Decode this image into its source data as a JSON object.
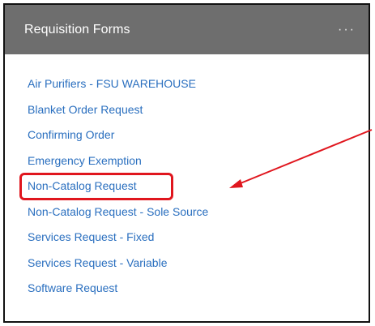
{
  "panel": {
    "title": "Requisition Forms",
    "more_icon": "more-horizontal-icon",
    "more_glyph": "···"
  },
  "forms": [
    {
      "label": "Air Purifiers - FSU WAREHOUSE"
    },
    {
      "label": "Blanket Order Request"
    },
    {
      "label": "Confirming Order"
    },
    {
      "label": "Emergency Exemption"
    },
    {
      "label": "Non-Catalog Request",
      "highlighted": true
    },
    {
      "label": "Non-Catalog Request - Sole Source"
    },
    {
      "label": "Services Request - Fixed"
    },
    {
      "label": "Services Request - Variable"
    },
    {
      "label": "Software Request"
    }
  ],
  "annotation": {
    "color": "#e0161e",
    "target": "Non-Catalog Request"
  },
  "colors": {
    "header_bg": "#6e6e6e",
    "link": "#2a6fbf",
    "annotation": "#e0161e"
  }
}
